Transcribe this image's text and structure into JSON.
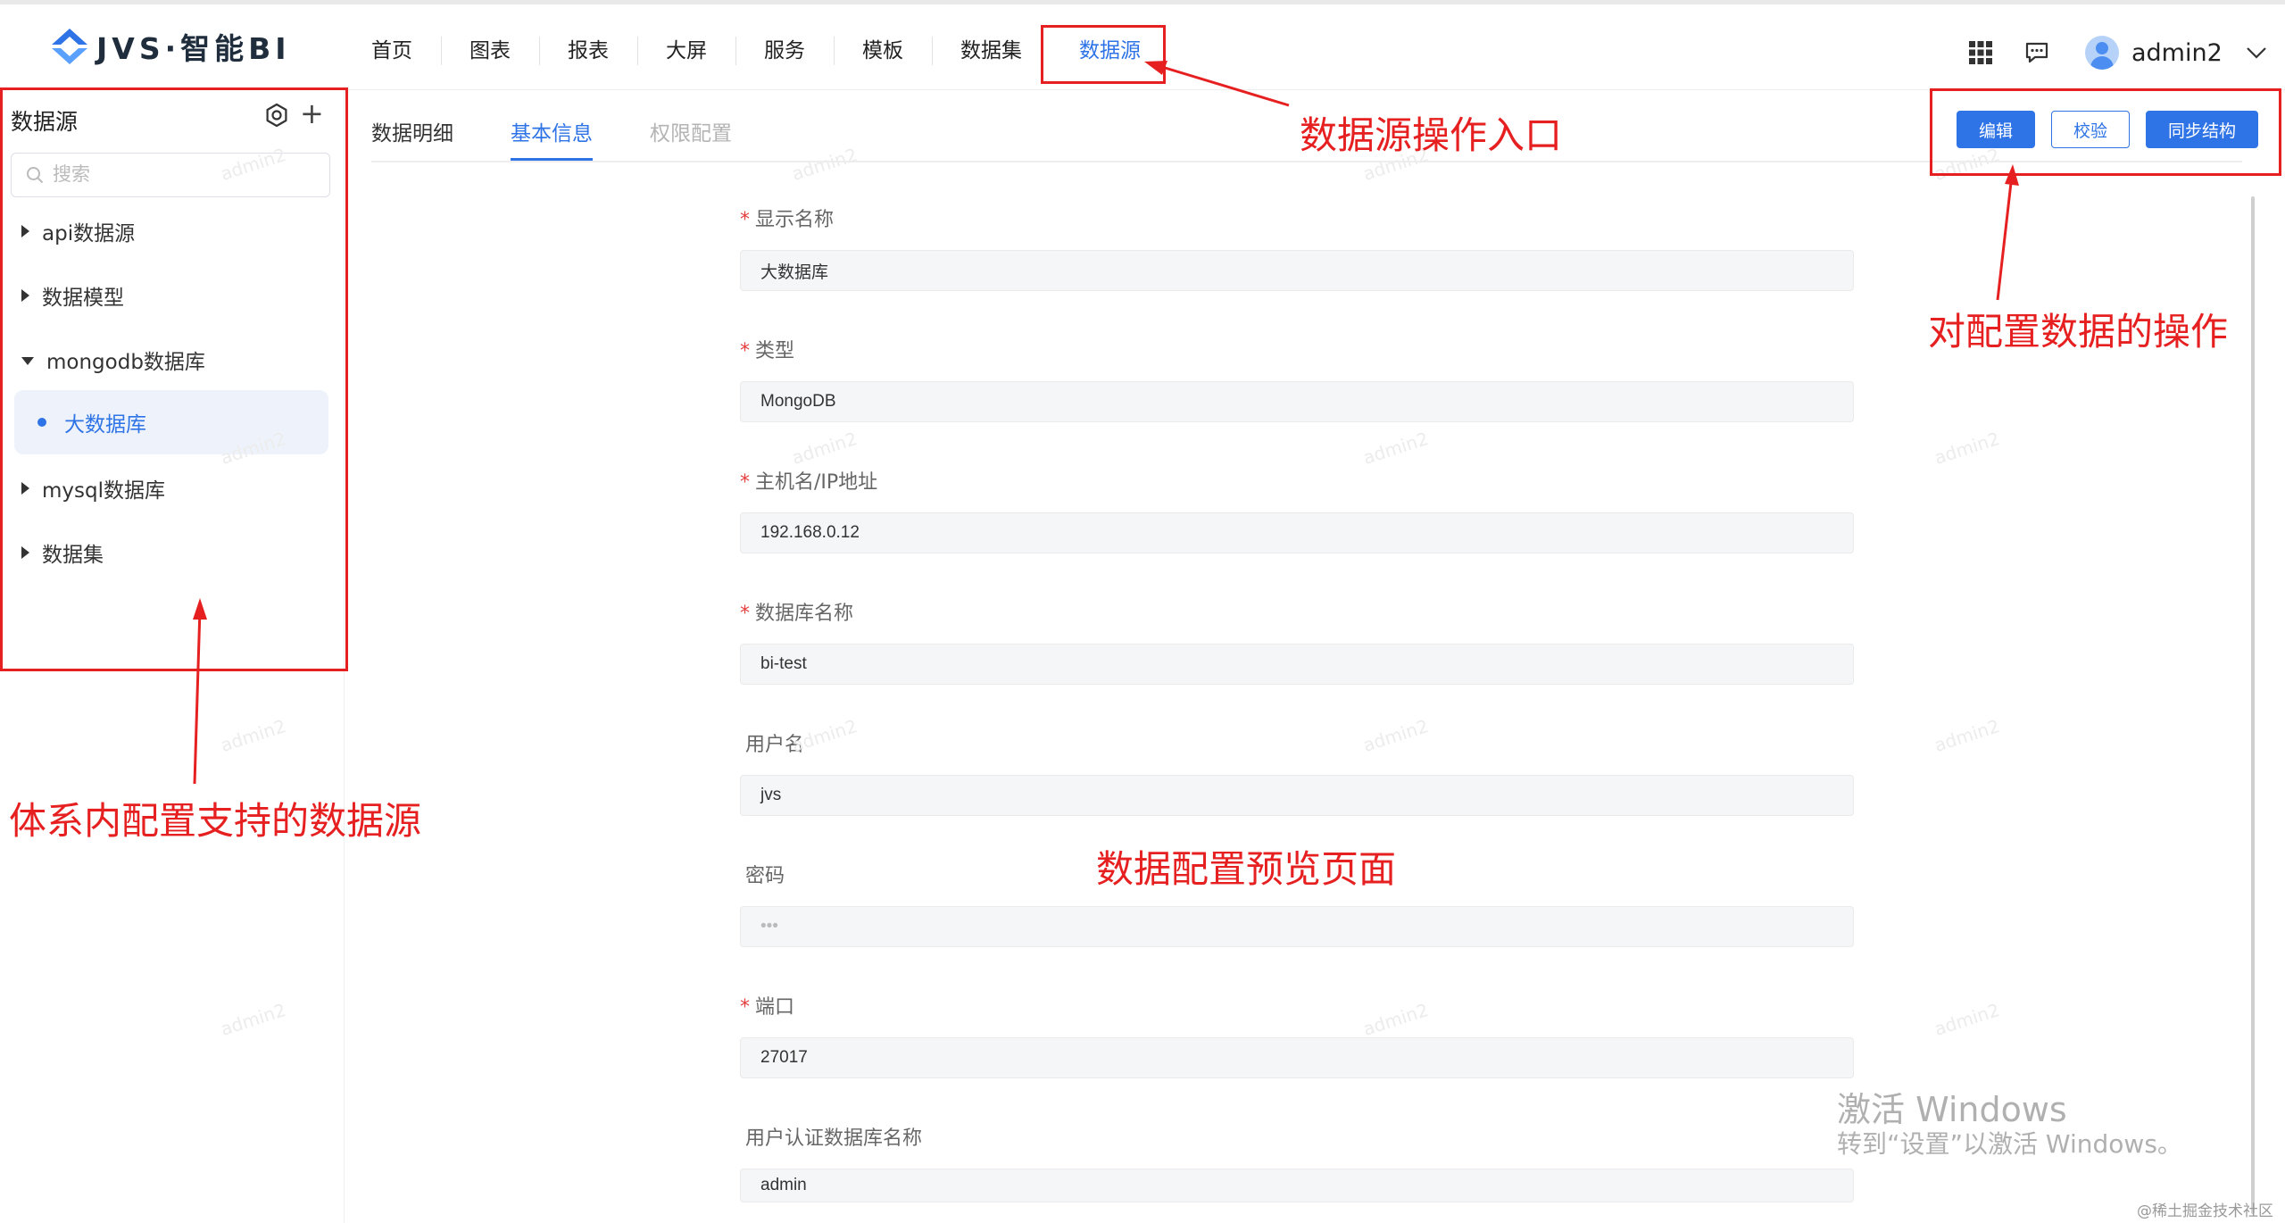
{
  "header": {
    "logo_text": "JVS·智能BI",
    "nav": [
      "首页",
      "图表",
      "报表",
      "大屏",
      "服务",
      "模板",
      "数据集",
      "数据源"
    ],
    "user_name": "admin2"
  },
  "sidebar": {
    "title": "数据源",
    "search_placeholder": "搜索",
    "groups": [
      "api数据源",
      "数据模型",
      "mongodb数据库",
      "mysql数据库",
      "数据集"
    ],
    "selected_leaf": "大数据库"
  },
  "tabs": [
    "数据明细",
    "基本信息",
    "权限配置"
  ],
  "actions": {
    "edit": "编辑",
    "verify": "校验",
    "sync": "同步结构"
  },
  "form": {
    "fields": [
      {
        "label": "显示名称",
        "required": "*",
        "value": "大数据库"
      },
      {
        "label": "类型",
        "required": "*",
        "value": "MongoDB"
      },
      {
        "label": "主机名/IP地址",
        "required": "*",
        "value": "192.168.0.12"
      },
      {
        "label": "数据库名称",
        "required": "*",
        "value": "bi-test"
      },
      {
        "label": "用户名",
        "required": "",
        "value": "jvs"
      },
      {
        "label": "密码",
        "required": "",
        "value": "•••"
      },
      {
        "label": "端口",
        "required": "*",
        "value": "27017"
      },
      {
        "label": "用户认证数据库名称",
        "required": "",
        "value": "admin"
      }
    ]
  },
  "annotations": {
    "entry": "数据源操作入口",
    "ops": "对配置数据的操作",
    "sources": "体系内配置支持的数据源",
    "preview": "数据配置预览页面"
  },
  "watermark": "admin2",
  "windows_activation": {
    "line1": "激活 Windows",
    "line2": "转到“设置”以激活 Windows。"
  },
  "credit": "@稀土掘金技术社区",
  "colors": {
    "accent": "#2f74e6",
    "annotation": "#e62020"
  }
}
